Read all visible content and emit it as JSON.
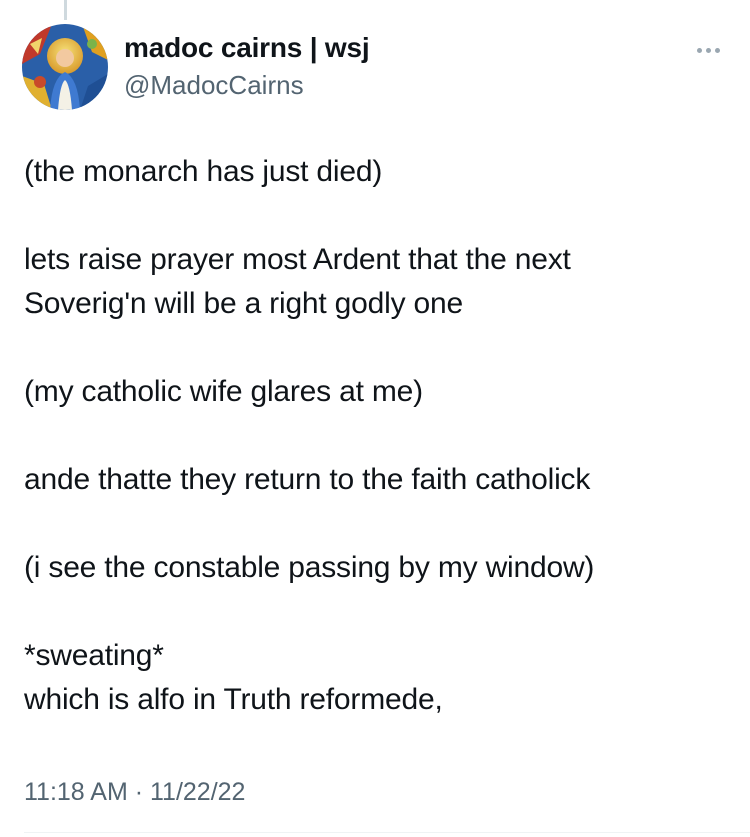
{
  "tweet": {
    "author": {
      "display_name": "madoc cairns | wsj",
      "handle": "@MadocCairns",
      "avatar_icon": "avatar-stained-glass-image"
    },
    "more_icon": "more-options-icon",
    "lines": [
      "(the monarch has just died)",
      "",
      "lets raise prayer most Ardent that the next",
      "Soverig'n will be a right godly one",
      "",
      "(my catholic wife glares at me)",
      "",
      "ande thatte they return to the faith catholick",
      "",
      "(i see the constable passing by my window)",
      "",
      "*sweating*",
      "which is alfo in Truth reformede,"
    ],
    "timestamp": "11:18 AM · 11/22/22"
  },
  "colors": {
    "text": "#0f1419",
    "secondary": "#536471",
    "divider": "#eff3f4"
  }
}
